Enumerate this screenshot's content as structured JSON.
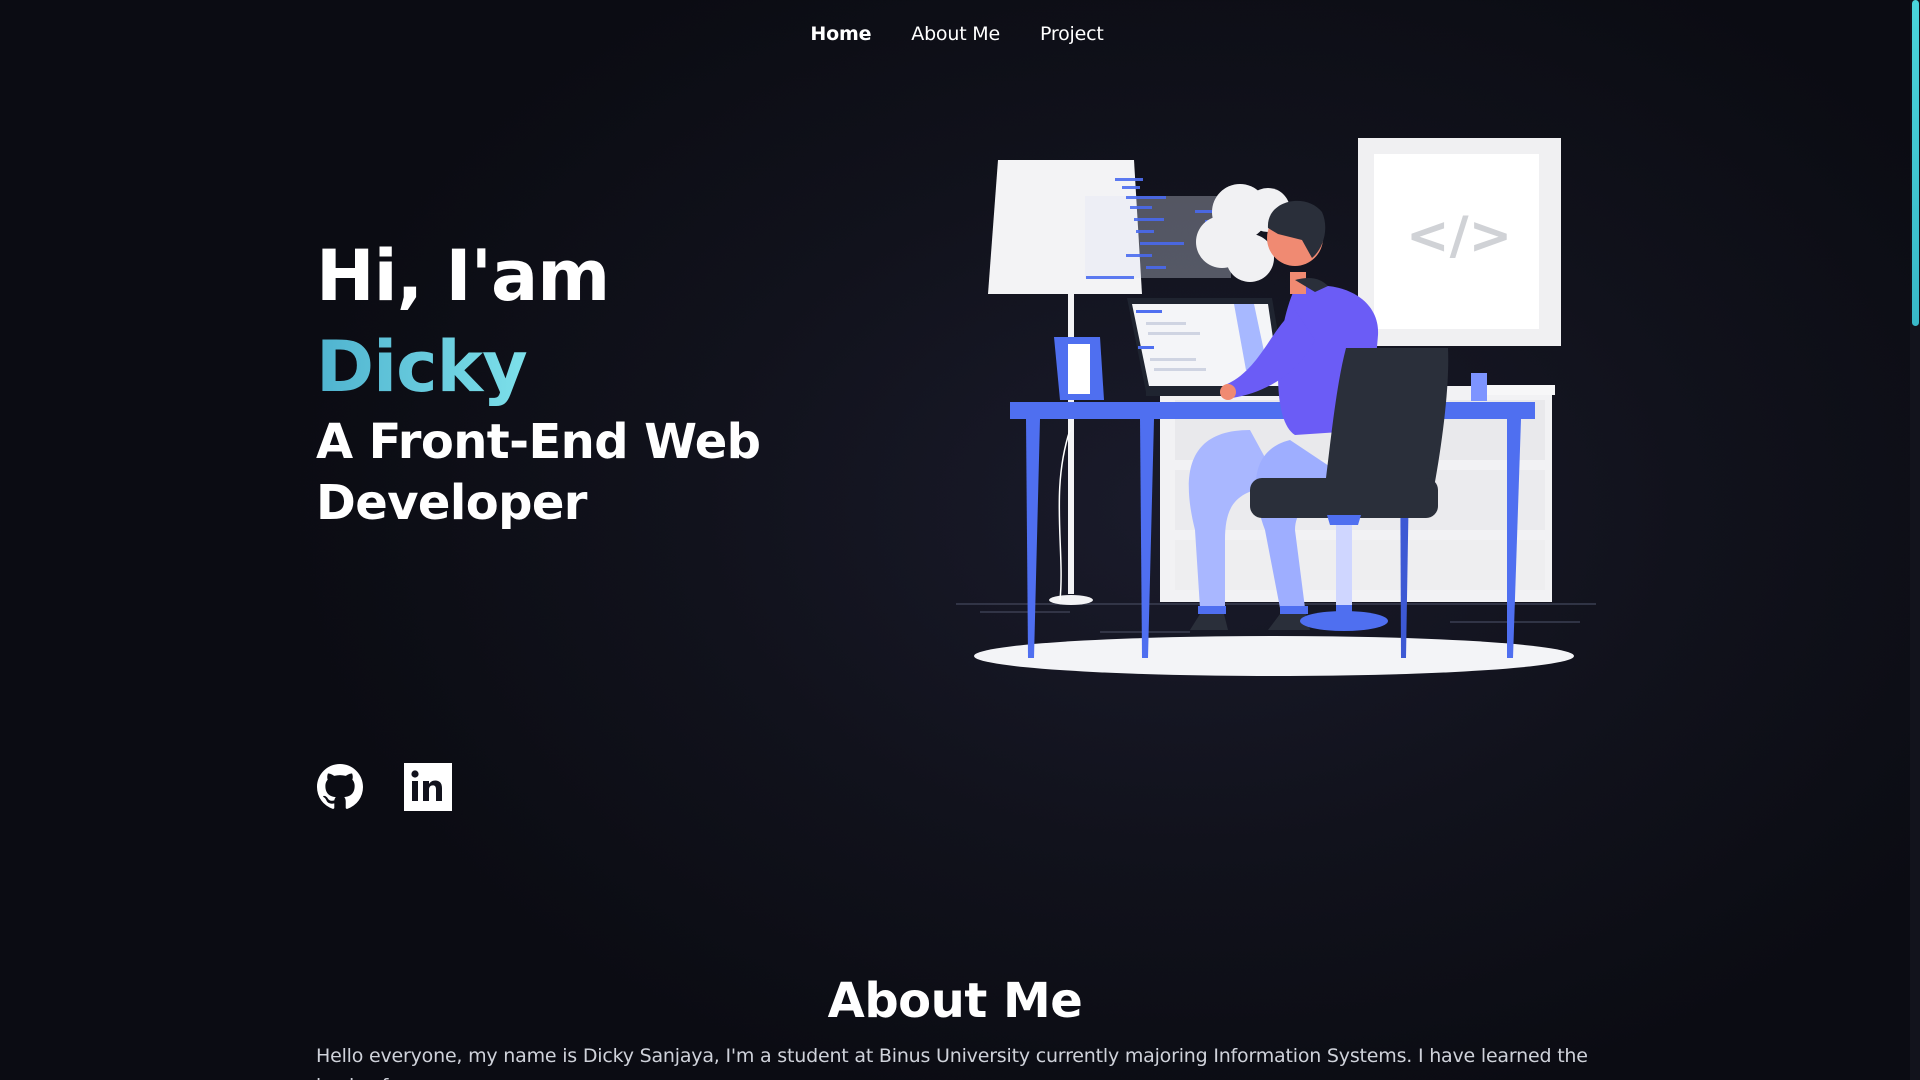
{
  "nav": {
    "items": [
      {
        "label": "Home",
        "active": true
      },
      {
        "label": "About Me",
        "active": false
      },
      {
        "label": "Project",
        "active": false
      }
    ]
  },
  "hero": {
    "greeting": "Hi, I'am",
    "name": "Dicky",
    "role": "A Front-End Web Developer",
    "name_gradient": [
      "#4fb3cf",
      "#7de0ea"
    ]
  },
  "illustration": {
    "monitor_code_symbol": "</>",
    "icon": "developer-at-desk-illustration"
  },
  "social": [
    {
      "name": "github",
      "icon": "github-icon"
    },
    {
      "name": "linkedin",
      "icon": "linkedin-icon",
      "text": "in"
    }
  ],
  "about": {
    "title": "About Me",
    "text": "Hello everyone, my name is Dicky Sanjaya, I'm a student at Binus University currently majoring Information Systems. I have learned the basic of"
  },
  "colors": {
    "background": "#11121c",
    "accent": "#4fb3cf",
    "illustration_blue": "#4f6ff0",
    "illustration_purple": "#6b5cf6"
  }
}
